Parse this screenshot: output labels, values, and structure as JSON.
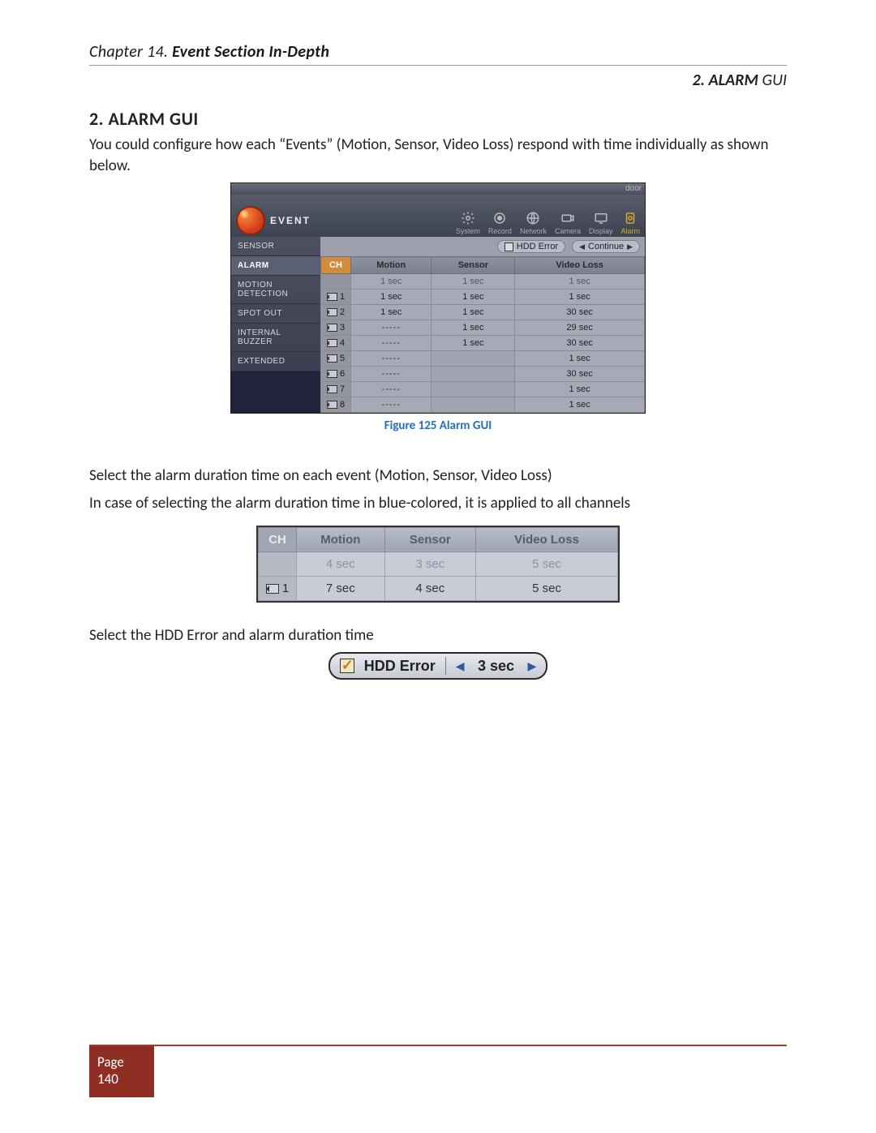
{
  "doc": {
    "chapter_prefix": "Chapter 14. ",
    "chapter_title": "Event Section In-Depth",
    "header_right_bold": "2. ALARM",
    "header_right_light": " GUI",
    "section_title": "2. ALARM GUI",
    "intro": "You could configure how each “Events” (Motion, Sensor, Video Loss) respond with time individually as shown below.",
    "fig_caption": "Figure 125 Alarm GUI",
    "para2_line1": "Select the alarm duration time on each event (Motion, Sensor, Video Loss)",
    "para2_line2": "In case of selecting the alarm duration time in blue-colored, it is applied to all channels",
    "para3": "Select the HDD Error and alarm duration time",
    "page_label": "Page",
    "page_number": "140"
  },
  "gui1": {
    "top_right": "door",
    "event_label": "EVENT",
    "nav": [
      "System",
      "Record",
      "Network",
      "Camera",
      "Display",
      "Alarm"
    ],
    "sidebar": [
      "SENSOR",
      "ALARM",
      "MOTION DETECTION",
      "SPOT OUT",
      "INTERNAL BUZZER",
      "EXTENDED"
    ],
    "sidebar_active_index": 1,
    "hdd_error_label": "HDD Error",
    "continue_label": "Continue",
    "headers": {
      "ch": "CH",
      "motion": "Motion",
      "sensor": "Sensor",
      "videoloss": "Video Loss"
    },
    "pre_row": {
      "motion": "1 sec",
      "sensor": "1 sec",
      "videoloss": "1 sec"
    },
    "rows": [
      {
        "ch": "1",
        "motion": "1 sec",
        "sensor": "1 sec",
        "videoloss": "1 sec"
      },
      {
        "ch": "2",
        "motion": "1 sec",
        "sensor": "1 sec",
        "videoloss": "30 sec"
      },
      {
        "ch": "3",
        "motion": "-----",
        "sensor": "1 sec",
        "videoloss": "29 sec"
      },
      {
        "ch": "4",
        "motion": "-----",
        "sensor": "1 sec",
        "videoloss": "30 sec"
      },
      {
        "ch": "5",
        "motion": "-----",
        "sensor": "",
        "videoloss": "1 sec"
      },
      {
        "ch": "6",
        "motion": "-----",
        "sensor": "",
        "videoloss": "30 sec"
      },
      {
        "ch": "7",
        "motion": "-----",
        "sensor": "",
        "videoloss": "1 sec"
      },
      {
        "ch": "8",
        "motion": "-----",
        "sensor": "",
        "videoloss": "1 sec"
      }
    ]
  },
  "gui2": {
    "headers": {
      "ch": "CH",
      "motion": "Motion",
      "sensor": "Sensor",
      "videoloss": "Video Loss"
    },
    "row_all": {
      "motion": "4 sec",
      "sensor": "3 sec",
      "videoloss": "5 sec"
    },
    "row1": {
      "ch": "1",
      "motion": "7 sec",
      "sensor": "4 sec",
      "videoloss": "5 sec"
    }
  },
  "gui3": {
    "label": "HDD Error",
    "value": "3 sec"
  }
}
